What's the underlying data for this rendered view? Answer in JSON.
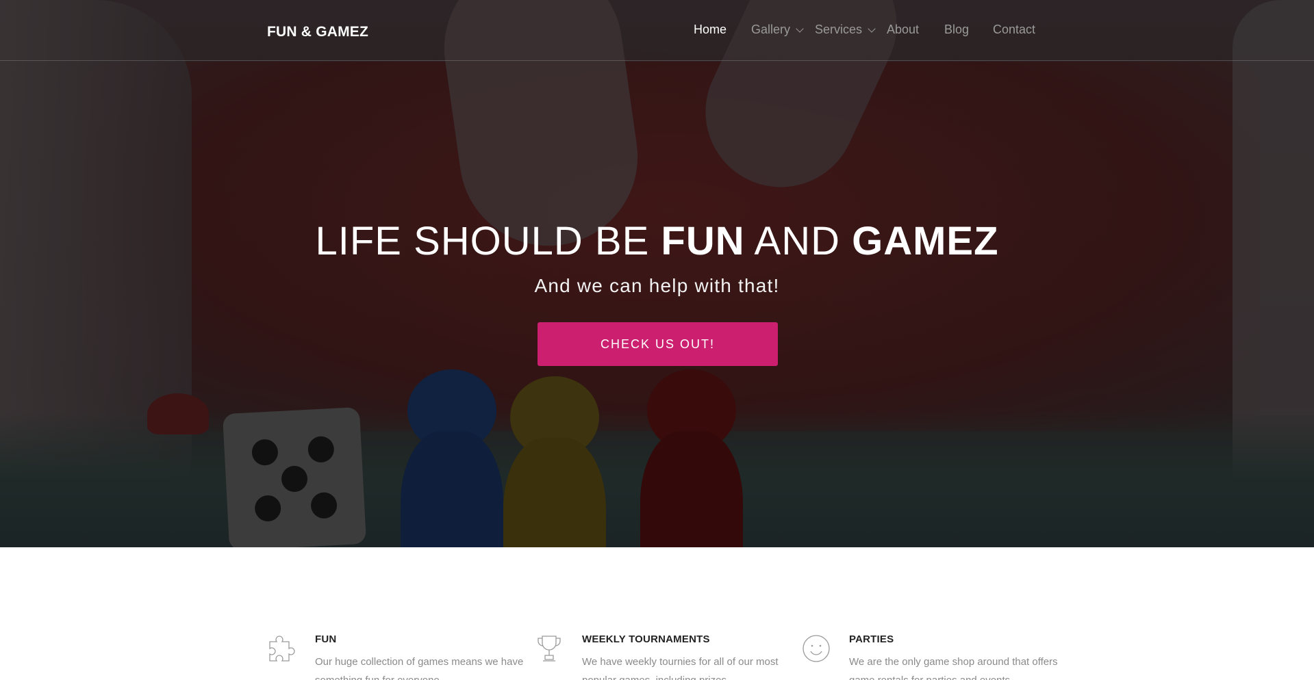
{
  "brand": {
    "name": "FUN & GAMEZ"
  },
  "nav": {
    "items": [
      {
        "label": "Home",
        "active": true,
        "dropdown": false
      },
      {
        "label": "Gallery",
        "active": false,
        "dropdown": true
      },
      {
        "label": "Services",
        "active": false,
        "dropdown": true
      },
      {
        "label": "About",
        "active": false,
        "dropdown": false
      },
      {
        "label": "Blog",
        "active": false,
        "dropdown": false
      },
      {
        "label": "Contact",
        "active": false,
        "dropdown": false
      }
    ]
  },
  "hero": {
    "headline_part1": "LIFE SHOULD BE ",
    "headline_bold1": "FUN",
    "headline_part2": " AND ",
    "headline_bold2": "GAMEZ",
    "subheadline": "And we can help with that!",
    "cta_label": "CHECK US OUT!"
  },
  "features": [
    {
      "icon": "puzzle-icon",
      "title": "FUN",
      "description": "Our huge collection of games means we have something fun for everyone."
    },
    {
      "icon": "trophy-icon",
      "title": "WEEKLY TOURNAMENTS",
      "description": "We have weekly tournies for all of our most popular games, including prizes."
    },
    {
      "icon": "smiley-icon",
      "title": "PARTIES",
      "description": "We are the only game shop around that offers game rentals for parties and events."
    }
  ],
  "colors": {
    "accent": "#cc1f6f",
    "nav_active": "#ffffff",
    "nav_inactive": "#9a9a9a",
    "feature_text": "#8a8a8a"
  }
}
